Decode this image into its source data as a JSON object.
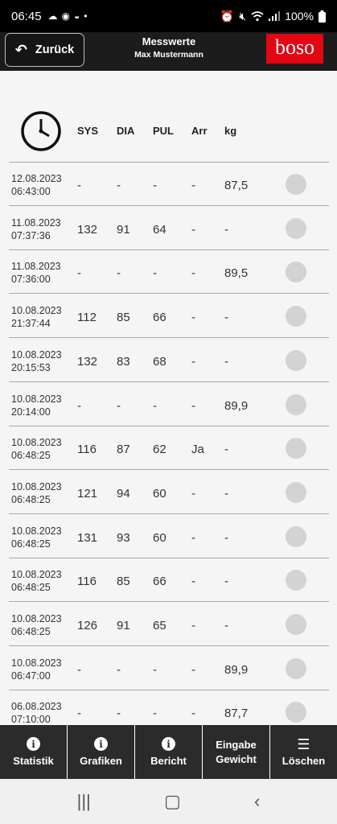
{
  "status_bar": {
    "time": "06:45",
    "battery": "100%",
    "left_icons": [
      "cloud-icon",
      "messenger-icon",
      "app-icon",
      "dot-icon"
    ],
    "right_icons": [
      "alarm-icon",
      "mute-icon",
      "wifi-icon",
      "signal-icon",
      "battery-icon"
    ]
  },
  "header": {
    "back_label": "Zurück",
    "title": "Messwerte",
    "subtitle": "Max Mustermann",
    "logo_text": "boso"
  },
  "table": {
    "columns": [
      "SYS",
      "DIA",
      "PUL",
      "Arr",
      "kg"
    ],
    "rows": [
      {
        "date": "12.08.2023",
        "time": "06:43:00",
        "sys": "-",
        "dia": "-",
        "pul": "-",
        "arr": "-",
        "kg": "87,5"
      },
      {
        "date": "11.08.2023",
        "time": "07:37:36",
        "sys": "132",
        "dia": "91",
        "pul": "64",
        "arr": "-",
        "kg": "-"
      },
      {
        "date": "11.08.2023",
        "time": "07:36:00",
        "sys": "-",
        "dia": "-",
        "pul": "-",
        "arr": "-",
        "kg": "89,5"
      },
      {
        "date": "10.08.2023",
        "time": "21:37:44",
        "sys": "112",
        "dia": "85",
        "pul": "66",
        "arr": "-",
        "kg": "-"
      },
      {
        "date": "10.08.2023",
        "time": "20:15:53",
        "sys": "132",
        "dia": "83",
        "pul": "68",
        "arr": "-",
        "kg": "-"
      },
      {
        "date": "10.08.2023",
        "time": "20:14:00",
        "sys": "-",
        "dia": "-",
        "pul": "-",
        "arr": "-",
        "kg": "89,9"
      },
      {
        "date": "10.08.2023",
        "time": "06:48:25",
        "sys": "116",
        "dia": "87",
        "pul": "62",
        "arr": "Ja",
        "kg": "-"
      },
      {
        "date": "10.08.2023",
        "time": "06:48:25",
        "sys": "121",
        "dia": "94",
        "pul": "60",
        "arr": "-",
        "kg": "-"
      },
      {
        "date": "10.08.2023",
        "time": "06:48:25",
        "sys": "131",
        "dia": "93",
        "pul": "60",
        "arr": "-",
        "kg": "-"
      },
      {
        "date": "10.08.2023",
        "time": "06:48:25",
        "sys": "116",
        "dia": "85",
        "pul": "66",
        "arr": "-",
        "kg": "-"
      },
      {
        "date": "10.08.2023",
        "time": "06:48:25",
        "sys": "126",
        "dia": "91",
        "pul": "65",
        "arr": "-",
        "kg": "-"
      },
      {
        "date": "10.08.2023",
        "time": "06:47:00",
        "sys": "-",
        "dia": "-",
        "pul": "-",
        "arr": "-",
        "kg": "89,9"
      },
      {
        "date": "06.08.2023",
        "time": "07:10:00",
        "sys": "-",
        "dia": "-",
        "pul": "-",
        "arr": "-",
        "kg": "87,7"
      }
    ]
  },
  "bottom_nav": [
    {
      "label": "Statistik",
      "icon": "info-icon"
    },
    {
      "label": "Grafiken",
      "icon": "info-icon"
    },
    {
      "label": "Bericht",
      "icon": "info-icon"
    },
    {
      "label": "Eingabe Gewicht",
      "icon": ""
    },
    {
      "label": "Löschen",
      "icon": "menu-icon"
    }
  ],
  "system_nav": [
    "recent-apps-icon",
    "home-icon",
    "back-icon"
  ]
}
